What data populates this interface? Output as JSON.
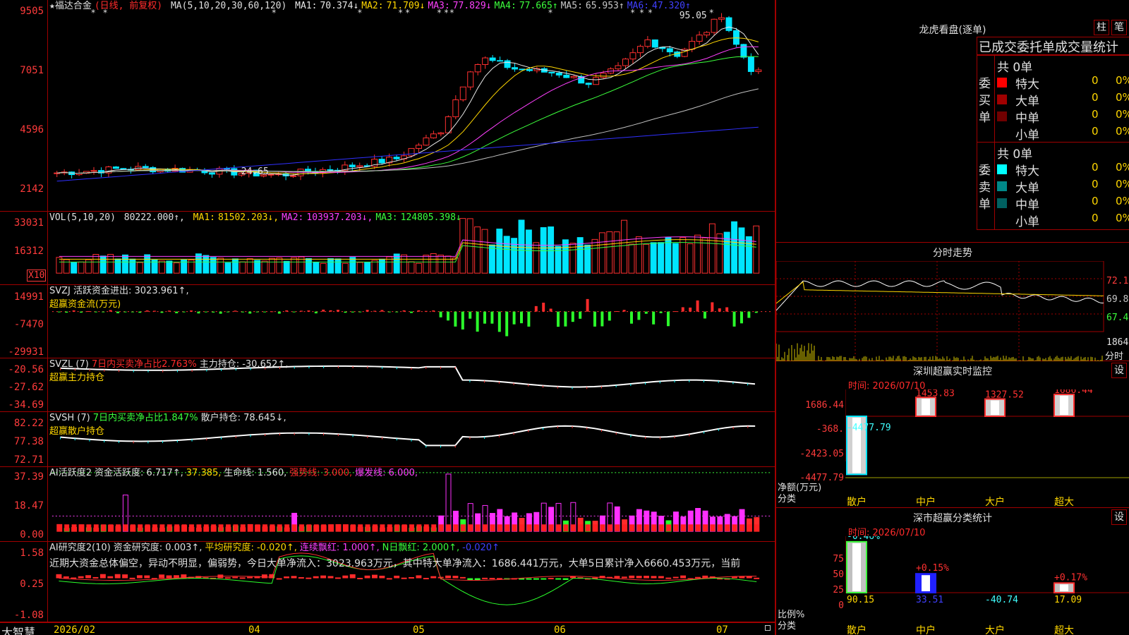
{
  "kline": {
    "stock_name": "★福达合金",
    "period_label": "(日线, 前复权)",
    "ma_header": "MA(5,10,20,30,60,120)",
    "ma": [
      {
        "label": "MA1:",
        "value": "70.374↓",
        "color": "#e8e8e8"
      },
      {
        "label": "MA2:",
        "value": "71.709↓",
        "color": "#ffd700"
      },
      {
        "label": "MA3:",
        "value": "77.829↓",
        "color": "#ff40ff"
      },
      {
        "label": "MA4:",
        "value": "77.665↑",
        "color": "#3cff3c"
      },
      {
        "label": "MA5:",
        "value": "65.953↑",
        "color": "#c8c8c8"
      },
      {
        "label": "MA6:",
        "value": "47.320↑",
        "color": "#4040ff"
      }
    ],
    "y_labels": [
      "9505",
      "7051",
      "4596",
      "2142"
    ],
    "high_marker": "95.05",
    "low_marker": "24.65",
    "star_glyph": "*"
  },
  "volume": {
    "header": "VOL(5,10,20)",
    "value": "80222.000↑,",
    "ma": [
      {
        "label": "MA1:",
        "value": "81502.203↓,",
        "color": "#ffd700"
      },
      {
        "label": "MA2:",
        "value": "103937.203↓,",
        "color": "#ff40ff"
      },
      {
        "label": "MA3:",
        "value": "124805.398↓",
        "color": "#3cff3c"
      }
    ],
    "y_labels": [
      "33031",
      "16312"
    ],
    "unit": "X10"
  },
  "svzj": {
    "header": "SVZJ 活跃资金进出: 3023.961↑,",
    "sub": "超赢资金流(万元)",
    "y_labels": [
      "14991",
      "-7470",
      "-29931"
    ]
  },
  "svzl": {
    "name": "SVZL (7)",
    "ratio": "7日内买卖净占比2.763%",
    "holding": "主力持仓: -30.652↑,",
    "sub": "超赢主力持仓",
    "y_labels": [
      "-20.56",
      "-27.62",
      "-34.69"
    ]
  },
  "svsh": {
    "name": "SVSH (7)",
    "ratio": "7日内买卖净占比1.847%",
    "holding": "散户持仓: 78.645↓,",
    "sub": "超赢散户持仓",
    "y_labels": [
      "82.22",
      "77.38",
      "72.71"
    ]
  },
  "ai_active": {
    "name": "AI活跃度2",
    "act": "资金活跃度: 6.717↑,",
    "v2": "37.385,",
    "life": "生命线: 1.560,",
    "strong": "强势线: 3.000,",
    "burst": "爆发线: 6.000,",
    "y_labels": [
      "37.39",
      "18.47",
      "0.00"
    ]
  },
  "ai_research": {
    "name": "AI研究度2(10)",
    "res": "资金研究度: 0.003↑,",
    "avg": "平均研究度: -0.020↑,",
    "red": "连续飘红: 1.000↑,",
    "nred": "N日飘红: 2.000↑,",
    "last": "-0.020↑",
    "comment": "近期大资金总体偏空，异动不明显，偏弱势，今日大单净流入：3023.963万元，其中特大单净流入：1686.441万元，大单5日累计净入6660.453万元，当前",
    "y_labels": [
      "1.58",
      "0.25",
      "-1.08"
    ]
  },
  "bottom": {
    "brand": "大智慧",
    "dates": [
      "2026/02",
      "04",
      "05",
      "06",
      "07"
    ]
  },
  "lhb": {
    "title": "龙虎看盘(逐单)",
    "btn_zhu": "柱",
    "btn_bi": "笔",
    "tabs": "已成交委托单成交量统计",
    "buy_label": "委买单",
    "sell_label": "委卖单",
    "buy_total": "共 0单",
    "sell_total": "共 0单",
    "buy_rows": [
      {
        "name": "特大",
        "num": "0",
        "pct": "0%",
        "color": "#ff0000"
      },
      {
        "name": "大单",
        "num": "0",
        "pct": "0%",
        "color": "#a00000"
      },
      {
        "name": "中单",
        "num": "0",
        "pct": "0%",
        "color": "#700000"
      },
      {
        "name": "小单",
        "num": "0",
        "pct": "0%",
        "color": ""
      }
    ],
    "sell_rows": [
      {
        "name": "特大",
        "num": "0",
        "pct": "0%",
        "color": "#00ffff"
      },
      {
        "name": "大单",
        "num": "0",
        "pct": "0%",
        "color": "#008888"
      },
      {
        "name": "中单",
        "num": "0",
        "pct": "0%",
        "color": "#006060"
      },
      {
        "name": "小单",
        "num": "0",
        "pct": "0%",
        "color": ""
      }
    ]
  },
  "intraday": {
    "title": "分时走势",
    "y_labels": [
      "72.10",
      "69.82",
      "67.48"
    ],
    "vol_label": "1864",
    "vol_unit": "分时"
  },
  "szjk": {
    "title": "深圳超赢实时监控",
    "settings": "设",
    "time": "时间: 2026/07/10",
    "y_labels": [
      "1686.44",
      "-368.",
      "-2423.05",
      "-4477.79"
    ],
    "unit": "净额(万元)",
    "cat_label": "分类",
    "chart_data": {
      "type": "bar",
      "categories": [
        "散户",
        "中户",
        "大户",
        "超大"
      ],
      "values": [
        -4477.79,
        1453.83,
        1327.52,
        1686.44
      ],
      "labels": [
        "-4477.79",
        "1453.83",
        "1327.52",
        "1686.44"
      ],
      "ylim": [
        -4477.79,
        1686.44
      ]
    }
  },
  "szfl": {
    "title": "深市超赢分类统计",
    "settings": "设",
    "time": "时间: 2026/07/10",
    "y_labels": [
      "75",
      "50",
      "25",
      "0"
    ],
    "unit": "比例%",
    "cat_label": "分类",
    "chart_data": {
      "type": "bar",
      "categories": [
        "散户",
        "中户",
        "大户",
        "超大"
      ],
      "values": [
        90.15,
        33.51,
        -40.74,
        17.09
      ],
      "changes": [
        "-0.46%",
        "+0.15%",
        "",
        "+0.17%"
      ],
      "value_labels": [
        "90.15",
        "33.51",
        "-40.74",
        "17.09"
      ],
      "ylim": [
        0,
        90
      ]
    }
  }
}
